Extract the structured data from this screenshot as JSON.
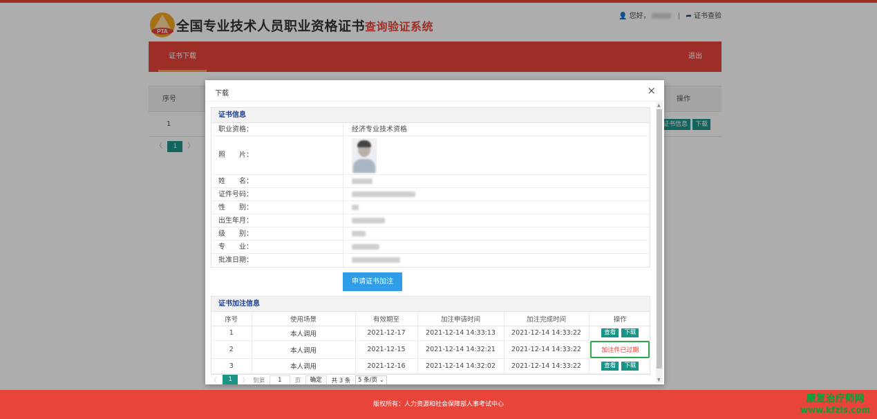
{
  "header": {
    "title_main": "全国专业技术人员职业资格证书",
    "title_sub": "查询验证系统",
    "logo_text": "PTA",
    "greeting": "您好，",
    "separator": "|",
    "verify_link": "证书查验"
  },
  "nav": {
    "tab": "证书下载",
    "logout": "退出"
  },
  "bg_table": {
    "col_no": "序号",
    "col_op": "操作",
    "row_no": "1",
    "btn_info": "证书信息",
    "btn_download": "下载",
    "pager_page": "1"
  },
  "modal": {
    "title": "下载",
    "close": "×",
    "cert_section": "证书信息",
    "fields": {
      "qualification_label": "职业资格：",
      "qualification_value": "经济专业技术资格",
      "photo_label": "照　　片：",
      "name_label": "姓　　名：",
      "cert_no_label": "证件号码：",
      "gender_label": "性　　别：",
      "birth_label": "出生年月：",
      "level_label": "级　　别：",
      "major_label": "专　　业：",
      "approve_label": "批准日期："
    },
    "apply_button": "申请证书加注",
    "annotation_section": "证书加注信息",
    "ann_headers": {
      "no": "序号",
      "scene": "使用场景",
      "valid": "有效期至",
      "apply_time": "加注申请时间",
      "done_time": "加注完成时间",
      "op": "操作"
    },
    "ann_rows": [
      {
        "no": "1",
        "scene": "本人调用",
        "valid": "2021-12-17",
        "apply_time": "2021-12-14 14:33:13",
        "done_time": "2021-12-14 14:33:22",
        "view": "查看",
        "download": "下载"
      },
      {
        "no": "2",
        "scene": "本人调用",
        "valid": "2021-12-15",
        "apply_time": "2021-12-14 14:32:21",
        "done_time": "2021-12-14 14:33:22",
        "status": "加注件已过期"
      },
      {
        "no": "3",
        "scene": "本人调用",
        "valid": "2021-12-16",
        "apply_time": "2021-12-14 14:32:02",
        "done_time": "2021-12-14 14:33:22",
        "view": "查看",
        "download": "下载"
      }
    ],
    "pager": {
      "prev": "〈",
      "current": "1",
      "next": "〉",
      "goto": "到第",
      "page_input": "1",
      "page_unit": "页",
      "confirm": "确定",
      "total": "共 3 条",
      "per_page": "5 条/页 ⌄"
    }
  },
  "footer": {
    "copyright": "版权所有：人力资源和社会保障部人事考试中心"
  },
  "watermark": {
    "line1": "康复治疗师网",
    "line2": "www.kfzls.com"
  },
  "colors": {
    "brand_red": "#e8443a",
    "teal": "#1b9488",
    "blue_button": "#2e9ee8",
    "section_title": "#1a3b8a"
  }
}
